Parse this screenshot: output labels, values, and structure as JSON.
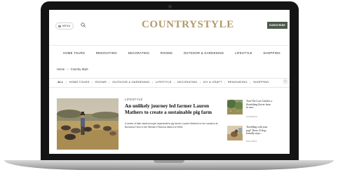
{
  "header": {
    "menu_label": "MENU",
    "logo_text": "COUNTRYSTYLE",
    "subscribe_label": "SUBSCRIBE"
  },
  "main_nav": [
    "HOME TOURS",
    "RENOVATING",
    "DECORATING",
    "ROOMS",
    "OUTDOOR & GARDENING",
    "LIFESTYLE",
    "SHOPPING"
  ],
  "breadcrumb": {
    "home": "Home",
    "separator": ">",
    "current": "Country Style"
  },
  "filter_nav": [
    "ALL",
    "HOME TOURS",
    "ROOMS",
    "OUTDOOR & GARDENING",
    "LIFESTYLE",
    "DECORATING",
    "DIY & CRAFT",
    "RENOVATING",
    "SHOPPING"
  ],
  "filter_separator": "|",
  "filter_arrow": "›",
  "hero": {
    "kicker": "LIFESTYLE",
    "headline": "An unlikely journey led farmer Lauren Mathers to create a sustainable pig farm",
    "excerpt": "A series of fake starts brought regenerative pig farmer Lauren Mathers to her vocation at Bundarra Farm in the Western Riverina district of NSW."
  },
  "side_stories": [
    {
      "title": "Tour The Love Garden, a flourishing flower farm in rura...",
      "tag": "GARDENS"
    },
    {
      "title": "Travelling with your pup? These 16 dog-friendly stays...",
      "tag": "ESCAPES"
    }
  ],
  "icons": {
    "menu": "hamburger-icon",
    "search": "search-icon",
    "scroll": "chevron-right-icon"
  },
  "colors": {
    "logo": "#b09a6a",
    "subscribe_bg": "#4d5a4b",
    "bezel": "#141414"
  }
}
